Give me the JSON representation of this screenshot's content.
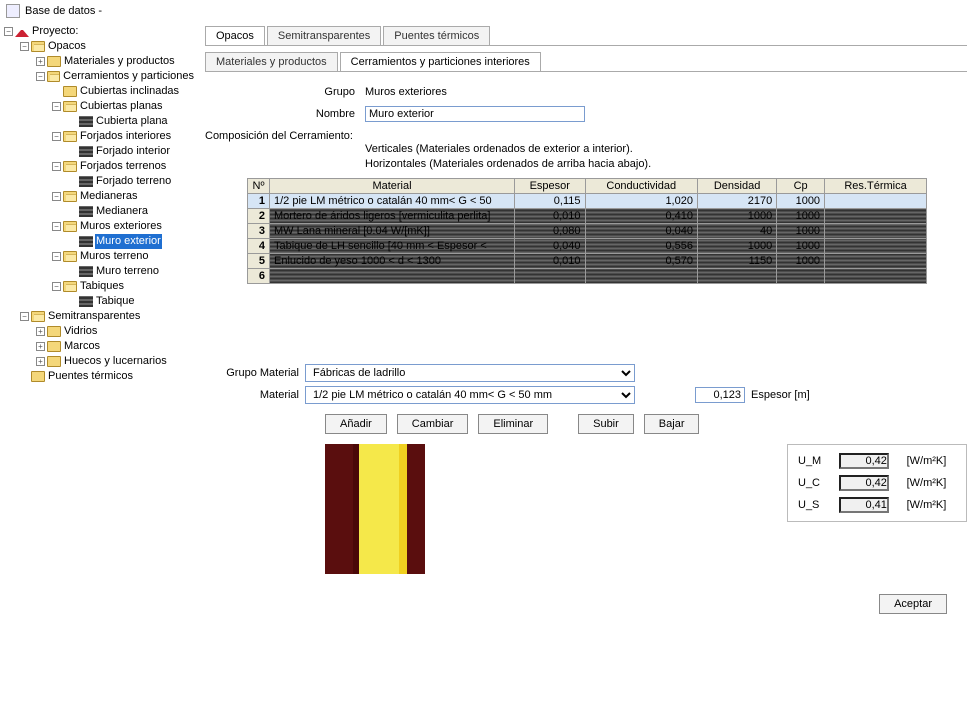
{
  "window_title": "Base de datos -",
  "tree": {
    "root": "Proyecto:",
    "opacos": "Opacos",
    "mat_prod": "Materiales y productos",
    "cerr_part": "Cerramientos y particiones",
    "cub_incl": "Cubiertas inclinadas",
    "cub_plan": "Cubiertas planas",
    "cub_plana": "Cubierta plana",
    "forj_int": "Forjados interiores",
    "forj_interior": "Forjado interior",
    "forj_ter": "Forjados terrenos",
    "forj_terreno": "Forjado terreno",
    "medianeras": "Medianeras",
    "medianera": "Medianera",
    "muros_ext": "Muros exteriores",
    "muro_exterior": "Muro exterior",
    "muros_ter": "Muros terreno",
    "muro_terreno": "Muro terreno",
    "tabiques": "Tabiques",
    "tabique": "Tabique",
    "semitrans": "Semitransparentes",
    "vidrios": "Vidrios",
    "marcos": "Marcos",
    "huecos": "Huecos y lucernarios",
    "puentes": "Puentes térmicos"
  },
  "tabs_top": {
    "opacos": "Opacos",
    "semi": "Semitransparentes",
    "puentes": "Puentes térmicos"
  },
  "tabs_sub": {
    "mat": "Materiales y productos",
    "cerr": "Cerramientos y particiones interiores"
  },
  "labels": {
    "grupo": "Grupo",
    "grupo_val": "Muros exteriores",
    "nombre": "Nombre",
    "nombre_val": "Muro exterior",
    "compo": "Composición del Cerramiento:",
    "compo_v": "Verticales (Materiales ordenados de exterior a interior).",
    "compo_h": "Horizontales (Materiales ordenados de arriba hacia abajo).",
    "grupo_mat": "Grupo Material",
    "grupo_mat_val": "Fábricas de ladrillo",
    "material": "Material",
    "material_val": "1/2 pie LM métrico o catalán 40 mm< G < 50 mm",
    "espesor": "Espesor [m]",
    "espesor_val": "0,123"
  },
  "table": {
    "headers": {
      "n": "Nº",
      "mat": "Material",
      "esp": "Espesor",
      "cond": "Conductividad",
      "dens": "Densidad",
      "cp": "Cp",
      "res": "Res.Térmica"
    },
    "rows": [
      {
        "n": "1",
        "mat": "1/2 pie LM métrico o catalán 40 mm< G < 50",
        "esp": "0,115",
        "cond": "1,020",
        "dens": "2170",
        "cp": "1000",
        "res": ""
      },
      {
        "n": "2",
        "mat": "Mortero de áridos ligeros [vermiculita perlita]",
        "esp": "0,010",
        "cond": "0,410",
        "dens": "1000",
        "cp": "1000",
        "res": ""
      },
      {
        "n": "3",
        "mat": "MW Lana mineral [0.04 W/[mK]]",
        "esp": "0,080",
        "cond": "0,040",
        "dens": "40",
        "cp": "1000",
        "res": ""
      },
      {
        "n": "4",
        "mat": "Tabique de LH sencillo [40 mm < Espesor <",
        "esp": "0,040",
        "cond": "0,556",
        "dens": "1000",
        "cp": "1000",
        "res": ""
      },
      {
        "n": "5",
        "mat": "Enlucido de yeso 1000 < d < 1300",
        "esp": "0,010",
        "cond": "0,570",
        "dens": "1150",
        "cp": "1000",
        "res": ""
      }
    ]
  },
  "buttons": {
    "anadir": "Añadir",
    "cambiar": "Cambiar",
    "eliminar": "Eliminar",
    "subir": "Subir",
    "bajar": "Bajar",
    "aceptar": "Aceptar"
  },
  "uvals": {
    "um": "U_M",
    "um_v": "0,42",
    "uc": "U_C",
    "uc_v": "0,42",
    "us": "U_S",
    "us_v": "0,41",
    "unit": "[W/m²K]"
  },
  "swatch_colors": [
    "#5a0e0e",
    "#4a0808",
    "#f5e84a",
    "#f0d020",
    "#5a0e0e"
  ],
  "swatch_widths": [
    28,
    6,
    40,
    8,
    18
  ]
}
